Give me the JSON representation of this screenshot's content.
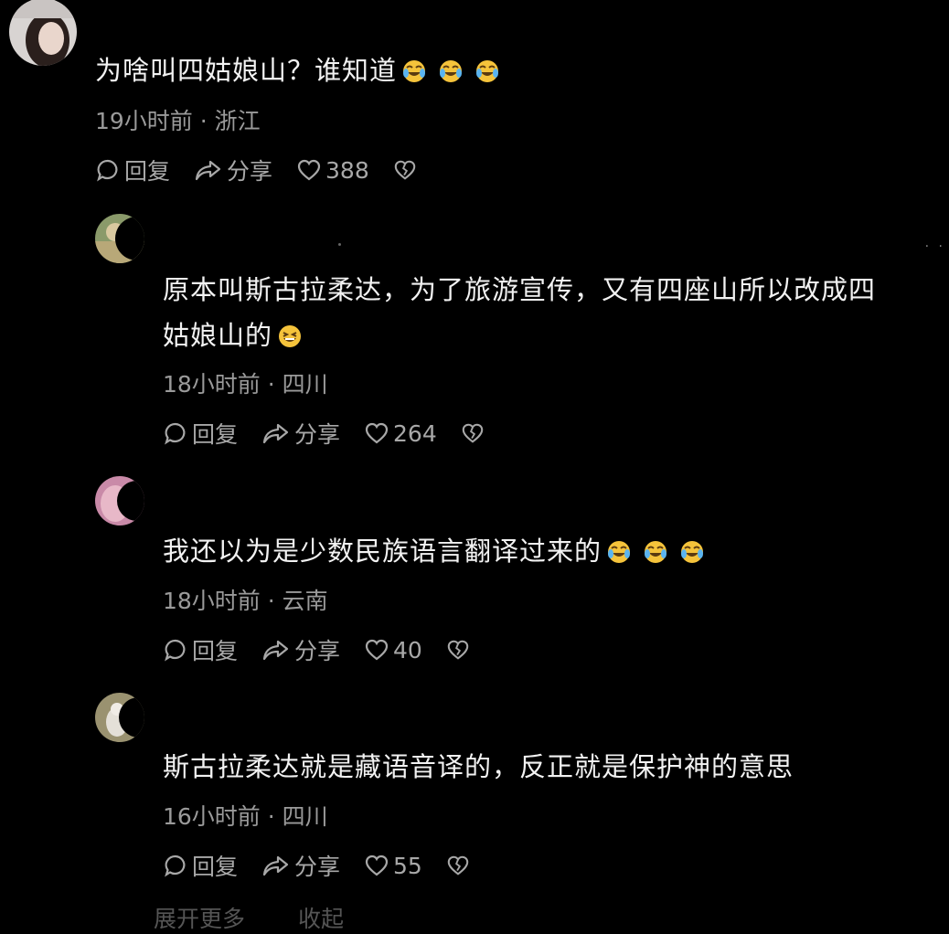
{
  "comments": [
    {
      "text": "为啥叫四姑娘山？谁知道",
      "emoji_count": 3,
      "meta": "19小时前 · 浙江",
      "reply_label": "回复",
      "share_label": "分享",
      "likes": "388"
    },
    {
      "text_line1": "原本叫斯古拉柔达，为了旅游宣传，又有四座山所以改成四",
      "text_line2": "姑娘山的",
      "meta": "18小时前 · 四川",
      "reply_label": "回复",
      "share_label": "分享",
      "likes": "264"
    },
    {
      "text": "我还以为是少数民族语言翻译过来的",
      "emoji_count": 3,
      "meta": "18小时前 · 云南",
      "reply_label": "回复",
      "share_label": "分享",
      "likes": "40"
    },
    {
      "text": "斯古拉柔达就是藏语音译的，反正就是保护神的意思",
      "meta": "16小时前 · 四川",
      "reply_label": "回复",
      "share_label": "分享",
      "likes": "55"
    }
  ],
  "footer": {
    "expand_label": "展开更多",
    "collapse_label": "收起"
  },
  "colors": {
    "background": "#000000",
    "text": "#f2f2f2",
    "meta": "#9a9a9a",
    "emoji": "#f5c33b"
  },
  "icons": [
    "reply-bubble-icon",
    "share-arrow-icon",
    "heart-icon",
    "broken-heart-icon",
    "laugh-cry-emoji",
    "grin-emoji"
  ]
}
